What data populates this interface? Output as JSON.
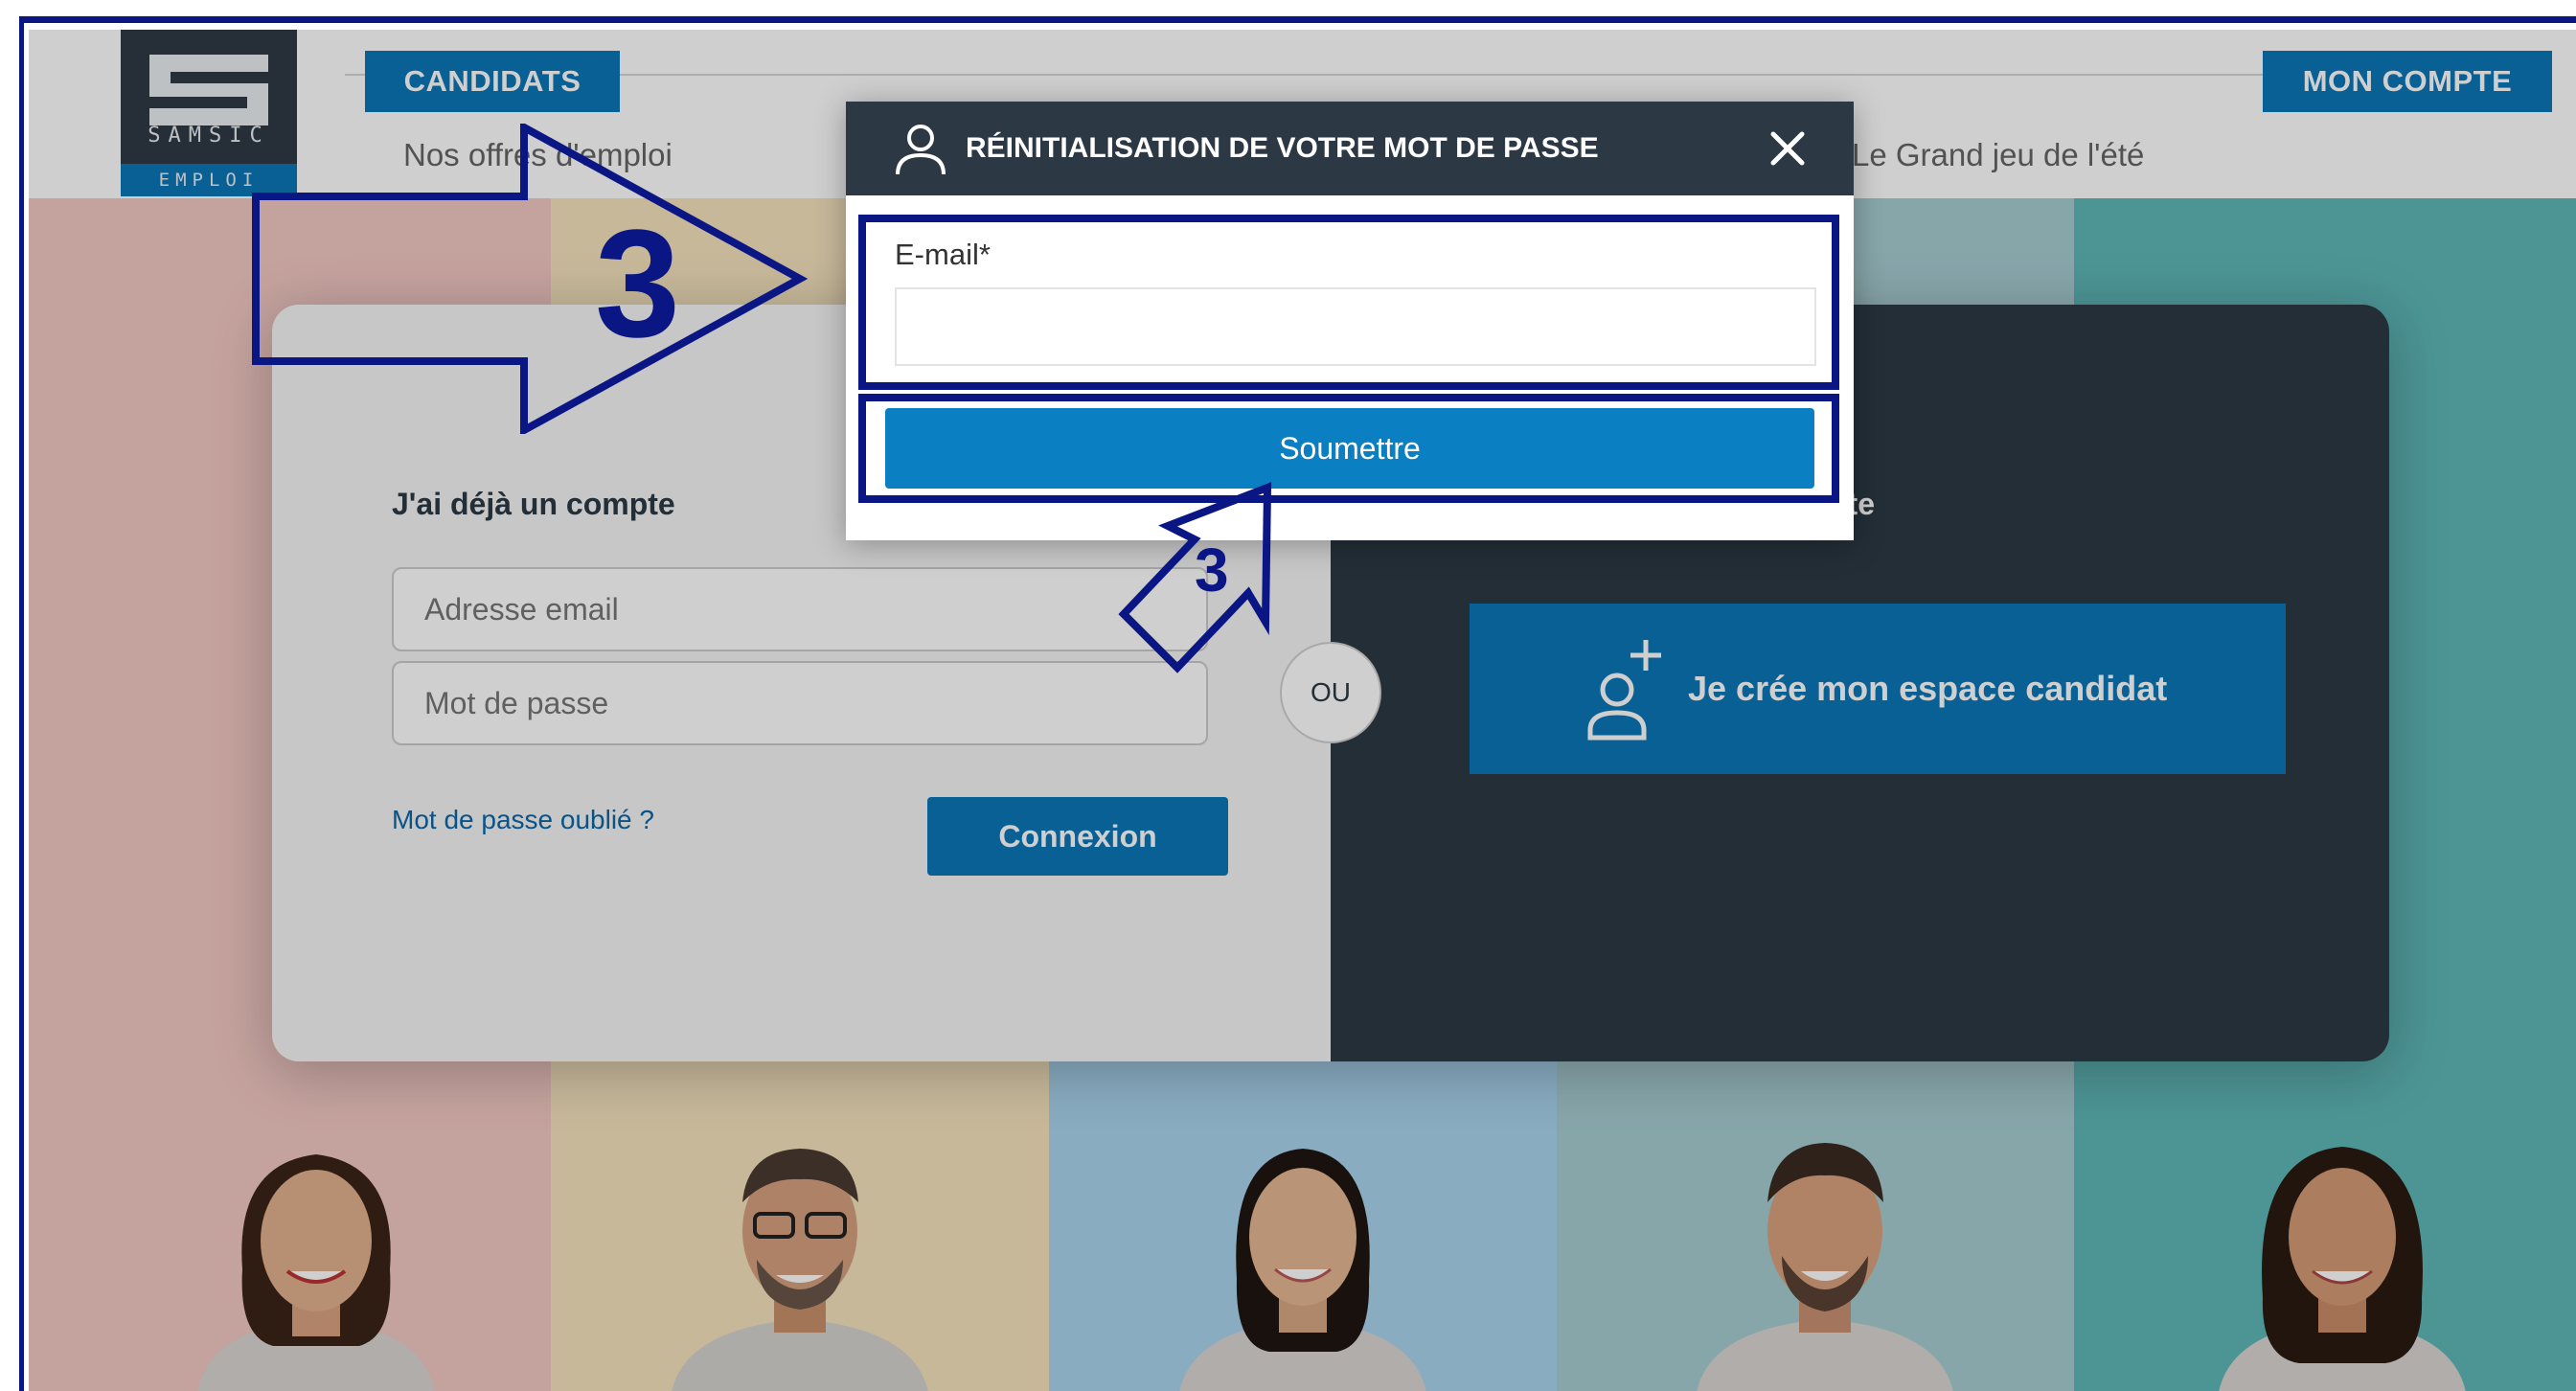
{
  "brand": {
    "logo_text": "SAMSIC",
    "logo_sub": "EMPLOI",
    "accent": "#0a77b8",
    "dark": "#2c3944",
    "annotation": "#0b1685"
  },
  "nav": {
    "candidats": "CANDIDATS",
    "mon_compte": "MON COMPTE",
    "sub_left": "Nos offres d'emploi",
    "sub_right": "Le Grand jeu de l'été"
  },
  "login": {
    "heading": "J'ai déjà un compte",
    "email_placeholder": "Adresse email",
    "password_placeholder": "Mot de passe",
    "forgot": "Mot de passe oublié ?",
    "connexion": "Connexion"
  },
  "divider": {
    "ou": "OU"
  },
  "signup": {
    "heading_fragment": "pte",
    "create_button": "Je crée mon espace candidat"
  },
  "modal": {
    "title": "RÉINITIALISATION DE VOTRE MOT DE PASSE",
    "email_label": "E-mail*",
    "email_value": "",
    "submit": "Soumettre"
  },
  "annotations": {
    "big_step": "3",
    "small_step": "3"
  },
  "icons": {
    "close": "close-icon",
    "user": "user-icon",
    "user_add": "user-add-icon"
  }
}
